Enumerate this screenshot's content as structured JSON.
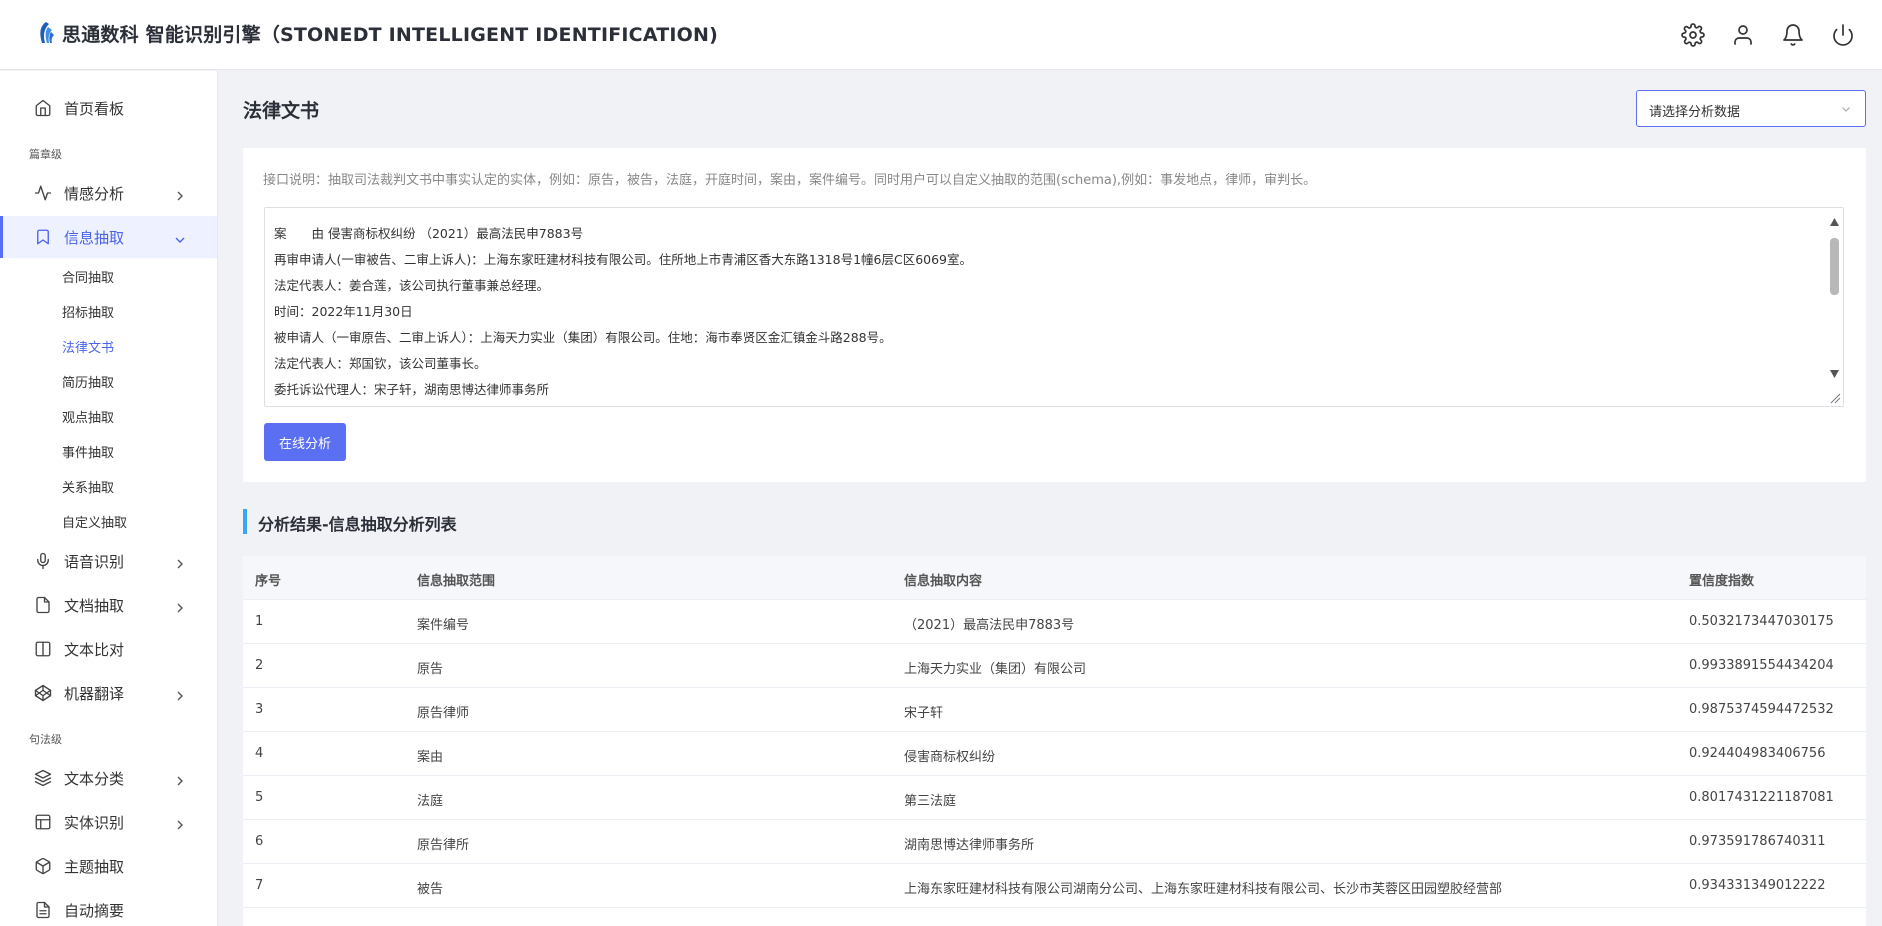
{
  "header": {
    "title": "思通数科 智能识别引擎（STONEDT INTELLIGENT IDENTIFICATION)",
    "icons": [
      "settings-icon",
      "user-icon",
      "bell-icon",
      "power-icon"
    ]
  },
  "sidebar": {
    "items": [
      {
        "label": "首页看板",
        "icon": "home-icon"
      },
      {
        "group": "篇章级"
      },
      {
        "label": "情感分析",
        "icon": "pulse-icon",
        "chevron": "right"
      },
      {
        "label": "信息抽取",
        "icon": "bookmark-icon",
        "chevron": "down",
        "active": true
      },
      {
        "label": "语音识别",
        "icon": "microphone-icon",
        "chevron": "right"
      },
      {
        "label": "文档抽取",
        "icon": "file-icon",
        "chevron": "right"
      },
      {
        "label": "文本比对",
        "icon": "columns-icon"
      },
      {
        "label": "机器翻译",
        "icon": "codepen-icon",
        "chevron": "right"
      },
      {
        "group": "句法级"
      },
      {
        "label": "文本分类",
        "icon": "layers-icon",
        "chevron": "right"
      },
      {
        "label": "实体识别",
        "icon": "layout-icon",
        "chevron": "right"
      },
      {
        "label": "主题抽取",
        "icon": "box-icon"
      },
      {
        "label": "自动摘要",
        "icon": "document-icon"
      }
    ],
    "group_labels": {
      "chapter": "篇章级",
      "sentence": "句法级"
    },
    "sub_items": [
      "合同抽取",
      "招标抽取",
      "法律文书",
      "简历抽取",
      "观点抽取",
      "事件抽取",
      "关系抽取",
      "自定义抽取"
    ],
    "active_sub": "法律文书"
  },
  "main": {
    "title": "法律文书",
    "select_placeholder": "请选择分析数据",
    "description": "接口说明：抽取司法裁判文书中事实认定的实体，例如：原告，被告，法庭，开庭时间，案由，案件编号。同时用户可以自定义抽取的范围(schema),例如：事发地点，律师，审判长。",
    "text_lines": [
      "案　　由 侵害商标权纠纷 （2021）最高法民申7883号",
      "再审申请人(一审被告、二审上诉人)：上海东家旺建材科技有限公司。住所地上市青浦区香大东路1318号1幢6层C区6069室。",
      "法定代表人：姜合莲，该公司执行董事兼总经理。",
      "时间：2022年11月30日",
      "被申请人（一审原告、二审上诉人）：上海天力实业（集团）有限公司。住地：海市奉贤区金汇镇金斗路288号。",
      "法定代表人：郑国钦，该公司董事长。",
      "委托诉讼代理人：宋子轩，湖南思博达律师事务所"
    ],
    "button_label": "在线分析",
    "section_title": "分析结果-信息抽取分析列表"
  },
  "table": {
    "columns": [
      "序号",
      "信息抽取范围",
      "信息抽取内容",
      "置信度指数"
    ],
    "rows": [
      [
        "1",
        "案件编号",
        "（2021）最高法民申7883号",
        "0.5032173447030175"
      ],
      [
        "2",
        "原告",
        "上海天力实业（集团）有限公司",
        "0.9933891554434204"
      ],
      [
        "3",
        "原告律师",
        "宋子轩",
        "0.9875374594472532"
      ],
      [
        "4",
        "案由",
        "侵害商标权纠纷",
        "0.924404983406756"
      ],
      [
        "5",
        "法庭",
        "第三法庭",
        "0.8017431221187081"
      ],
      [
        "6",
        "原告律所",
        "湖南思博达律师事务所",
        "0.973591786740311"
      ],
      [
        "7",
        "被告",
        "上海东家旺建材科技有限公司湖南分公司、上海东家旺建材科技有限公司、长沙市芙蓉区田园塑胶经营部",
        "0.934331349012222"
      ]
    ]
  },
  "colors": {
    "accent": "#5b6ff2",
    "section_bar": "#3aa4f5",
    "active_bg": "#eef1ff"
  }
}
